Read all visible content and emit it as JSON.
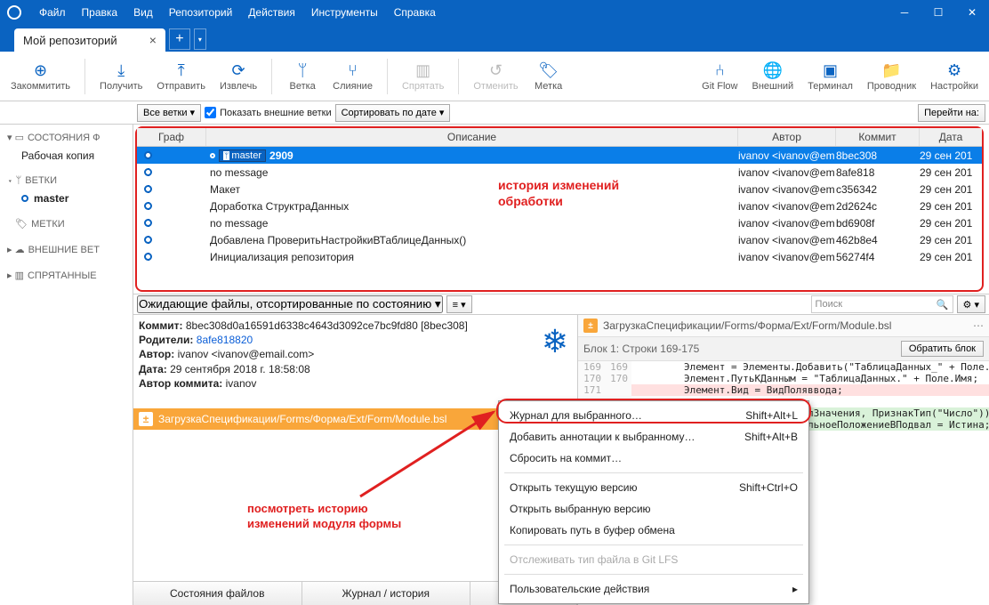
{
  "menu": {
    "file": "Файл",
    "edit": "Правка",
    "view": "Вид",
    "repo": "Репозиторий",
    "actions": "Действия",
    "tools": "Инструменты",
    "help": "Справка"
  },
  "tab": {
    "title": "Мой репозиторий"
  },
  "toolbar": {
    "commit": "Закоммитить",
    "pull": "Получить",
    "push": "Отправить",
    "fetch": "Извлечь",
    "branch": "Ветка",
    "merge": "Слияние",
    "stash": "Спрятать",
    "discard": "Отменить",
    "tag": "Метка",
    "gitflow": "Git Flow",
    "remote": "Внешний",
    "terminal": "Терминал",
    "explorer": "Проводник",
    "settings": "Настройки"
  },
  "filters": {
    "branches": "Все ветки",
    "showRemote": "Показать внешние ветки",
    "sort": "Сортировать по дате",
    "jump": "Перейти на:"
  },
  "sidebar": {
    "state": "СОСТОЯНИЯ Ф",
    "workingCopy": "Рабочая копия",
    "branches": "ВЕТКИ",
    "master": "master",
    "tags": "МЕТКИ",
    "remotes": "ВНЕШНИЕ ВЕТ",
    "stashes": "СПРЯТАННЫЕ"
  },
  "history": {
    "cols": {
      "graph": "Граф",
      "desc": "Описание",
      "author": "Автор",
      "commit": "Коммит",
      "date": "Дата"
    },
    "rows": [
      {
        "desc": "2909",
        "author": "ivanov <ivanov@em",
        "commit": "8bec308",
        "date": "29 сен 201",
        "master": true
      },
      {
        "desc": "no message",
        "author": "ivanov <ivanov@em",
        "commit": "8afe818",
        "date": "29 сен 201"
      },
      {
        "desc": "Макет",
        "author": "ivanov <ivanov@em",
        "commit": "c356342",
        "date": "29 сен 201"
      },
      {
        "desc": "Доработка СтруктраДанных",
        "author": "ivanov <ivanov@em",
        "commit": "2d2624c",
        "date": "29 сен 201"
      },
      {
        "desc": "no message",
        "author": "ivanov <ivanov@em",
        "commit": "bd6908f",
        "date": "29 сен 201"
      },
      {
        "desc": "Добавлена ПроверитьНастройкиВТаблицеДанных()",
        "author": "ivanov <ivanov@em",
        "commit": "462b8e4",
        "date": "29 сен 201"
      },
      {
        "desc": "Инициализация репозитория",
        "author": "ivanov <ivanov@em",
        "commit": "56274f4",
        "date": "29 сен 201"
      }
    ],
    "annot": "история изменений\nобработки"
  },
  "pending": {
    "label": "Ожидающие файлы, отсортированные по состоянию",
    "search": "Поиск"
  },
  "commitInfo": {
    "commitLabel": "Коммит:",
    "commitVal": "8bec308d0a16591d6338c4643d3092ce7bc9fd80 [8bec308]",
    "parentsLabel": "Родители:",
    "parentsVal": "8afe818820",
    "authorLabel": "Автор:",
    "authorVal": "ivanov <ivanov@email.com>",
    "dateLabel": "Дата:",
    "dateVal": "29 сентября 2018 г. 18:58:08",
    "committerLabel": "Автор коммита:",
    "committerVal": "ivanov"
  },
  "file": {
    "path": "ЗагрузкаСпецификации/Forms/Форма/Ext/Form/Module.bsl"
  },
  "bottomTabs": {
    "state": "Состояния файлов",
    "log": "Журнал / история"
  },
  "codeHead": {
    "path": "ЗагрузкаСпецификации/Forms/Форма/Ext/Form/Module.bsl",
    "hunk": "Блок 1: Строки 169-175",
    "revert": "Обратить блок"
  },
  "code": {
    "l1a": "169",
    "l1b": "169",
    "t1": "        Элемент = Элементы.Добавить(\"ТаблицаДанных_\" + Поле.Имя,",
    "l2a": "170",
    "l2b": "170",
    "t2": "        Элемент.ПутьКДанным = \"ТаблицаДанных.\" + Поле.Имя;",
    "l3a": "171",
    "l3b": "",
    "t3": "        Элемент.Вид = ВидПоляввода;",
    "l4a": "",
    "l4b": "",
    "t4": " ",
    "l5a": "",
    "l5b": "",
    "t5": "        Если СтрНайти(Поле.ТипЗначения, ПризнакТип(\"Число\")) Тогда",
    "l6a": "",
    "l6b": "",
    "t6": "            Элемент.ГоризонтальноеПоложениеВПодвал = Истина;"
  },
  "context": {
    "log": "Журнал для выбранного…",
    "logKey": "Shift+Alt+L",
    "annotate": "Добавить аннотации к выбранному…",
    "annotateKey": "Shift+Alt+B",
    "reset": "Сбросить на коммит…",
    "openCurrent": "Открыть текущую версию",
    "openCurrentKey": "Shift+Ctrl+O",
    "openSelected": "Открыть выбранную версию",
    "copyPath": "Копировать путь в буфер обмена",
    "lfs": "Отслеживать тип файла в Git LFS",
    "custom": "Пользовательские действия"
  },
  "annot2": "посмотреть историю\nизменений модуля формы",
  "masterBadge": "master"
}
